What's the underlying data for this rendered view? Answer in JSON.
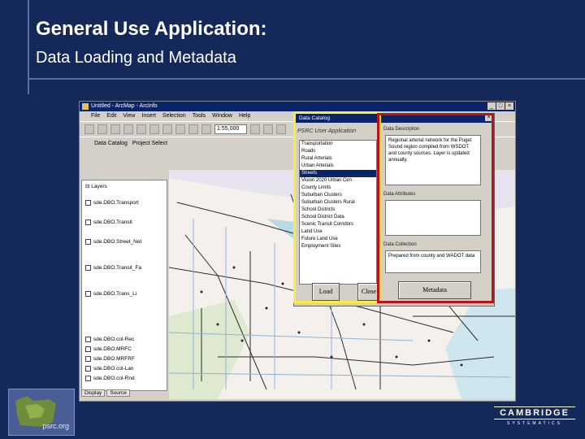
{
  "slide": {
    "title": "General Use Application:",
    "subtitle": "Data Loading and Metadata"
  },
  "app": {
    "window_title": "Untitled - ArcMap - ArcInfo",
    "menu": [
      "File",
      "Edit",
      "View",
      "Insert",
      "Selection",
      "Tools",
      "Window",
      "Help"
    ],
    "scale_value": "1:55,000",
    "toolbar2": [
      "Data Catalog",
      "Project Select"
    ],
    "toc": {
      "root_label": "Layers",
      "items": [
        "sde.DBO.Transport",
        "sde.DBO.Transit",
        "sde.DBO.Street_Net",
        "sde.DBO.Transit_Fa",
        "sde.DBO.Trans_Li",
        "sde.DBO.col-Rec",
        "sde.DBO.MRFC",
        "sde.DBO.MRFRF",
        "sde.DBO.col-Lan",
        "sde.DBO.col-Rnd"
      ],
      "tabs": [
        "Display",
        "Source"
      ]
    },
    "tools": [
      "zoom-in-icon",
      "zoom-out-icon",
      "pan-icon",
      "globe-icon",
      "back-icon",
      "forward-icon",
      "select-icon",
      "info-icon"
    ]
  },
  "dialog": {
    "title": "Data Catalog",
    "banner": "PSRC User Application",
    "catalog_items": [
      "Transportation",
      "Roads",
      "Rural Arterials",
      "Urban Arterials",
      "Streets",
      "Vision 2020 Urban Cen",
      "County Limits",
      "Suburban Clusters",
      "Suburban Clusters Rural",
      "School Districts",
      "School District Data",
      "Scenic Transit Corridors",
      "Land Use",
      "Future Land Use",
      "Employment Sites"
    ],
    "selected_index": 4,
    "description_label": "Data Description",
    "description": "Regional arterial network for the Puget Sound region compiled from WSDOT and county sources. Layer is updated annually.",
    "fields_label": "Data Attributes",
    "fields": "",
    "collection_label": "Data Collection",
    "collection": "Prepared from county and WADOT data",
    "buttons": {
      "load": "Load",
      "close": "Close",
      "metadata": "Metadata"
    }
  },
  "logos": {
    "psrc": "psrc.org",
    "cambridge": "CAMBRIDGE",
    "cambridge_sub": "SYSTEMATICS"
  }
}
